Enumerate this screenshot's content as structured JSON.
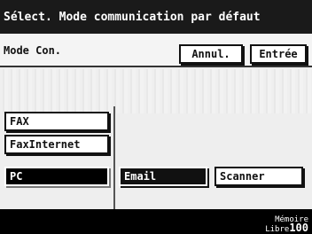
{
  "header": {
    "title": "Sélect. Mode communication par défaut"
  },
  "topbar": {
    "mode_label": "Mode Con.",
    "cancel_label": "Annul.",
    "enter_label": "Entrée"
  },
  "modes": [
    {
      "label": "FAX",
      "selected": false
    },
    {
      "label": "FaxInternet",
      "selected": false
    },
    {
      "label": "PC",
      "selected": true
    }
  ],
  "options": [
    {
      "label": "Email",
      "selected": true
    },
    {
      "label": "Scanner",
      "selected": false
    }
  ],
  "footer": {
    "memoire_line1": "Mémoire",
    "memoire_line2": "Libre",
    "memoire_value": "100"
  }
}
